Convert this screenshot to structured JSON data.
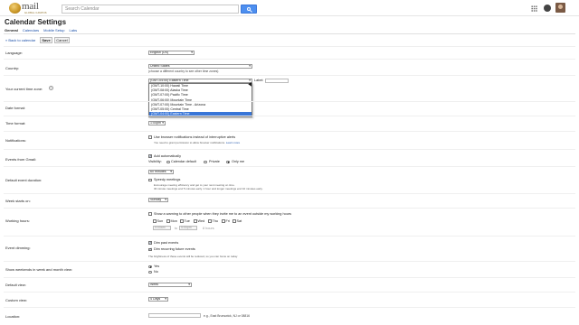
{
  "header": {
    "logo_text": "mail",
    "logo_subtext": "GLOBAL CAMPUS",
    "search_placeholder": "Search Calendar",
    "icons": [
      "search-icon",
      "apps-grid-icon",
      "notifications-icon",
      "avatar"
    ]
  },
  "page": {
    "title": "Calendar Settings",
    "tabs": [
      {
        "label": "General",
        "active": true
      },
      {
        "label": "Calendars",
        "active": false
      },
      {
        "label": "Mobile Setup",
        "active": false
      },
      {
        "label": "Labs",
        "active": false
      }
    ],
    "back_link": "« Back to calendar",
    "save_label": "Save",
    "cancel_label": "Cancel"
  },
  "settings": {
    "language": {
      "label": "Language:",
      "value": "English (US)"
    },
    "country": {
      "label": "Country:",
      "value": "United States",
      "hint": "(choose a different country to see other time zones)"
    },
    "timezone": {
      "label": "Your current time zone:",
      "help": "?",
      "value": "(GMT-04:00) Eastern Time",
      "side_label": "Label:",
      "options": [
        "(GMT-10:00) Hawaii Time",
        "(GMT-08:00) Alaska Time",
        "(GMT-07:00) Pacific Time",
        "(GMT-06:00) Mountain Time",
        "(GMT-07:00) Mountain Time - Arizona",
        "(GMT-05:00) Central Time",
        "(GMT-04:00) Eastern Time"
      ],
      "selected_index": 6
    },
    "date_format": {
      "label": "Date format:"
    },
    "time_format": {
      "label": "Time format:",
      "value": "1:00pm"
    },
    "notifications": {
      "label": "Notifications:",
      "checkbox": "Use browser notifications instead of interruptive alerts",
      "checked": false,
      "note": "You need to grant permission to allow browser notifications.",
      "note_link": "Learn more"
    },
    "events_from_gmail": {
      "label": "Events from Gmail:",
      "checkbox": "Add automatically",
      "checked": true,
      "visibility_label": "Visibility:",
      "visibility_options": [
        "Calendar default",
        "Private",
        "Only me"
      ],
      "visibility_selected": 2
    },
    "default_duration": {
      "label": "Default event duration:",
      "value": "60 minutes",
      "speedy_label": "Speedy meetings",
      "speedy_checked": false,
      "speedy_note1": "Encourage meeting efficiency and get to your next meeting on time.",
      "speedy_note2": "30 minute meetings end 5 minutes early. 1 hour and longer meetings end 10 minutes early."
    },
    "week_start": {
      "label": "Week starts on:",
      "value": "Sunday"
    },
    "working_hours": {
      "label": "Working hours:",
      "checkbox": "Show a warning to other people when they invite me to an event outside my working hours",
      "checked": false,
      "days": [
        "Sun",
        "Mon",
        "Tue",
        "Wed",
        "Thu",
        "Fri",
        "Sat"
      ],
      "from": "9:00am",
      "to_label": "to",
      "to": "5:00pm",
      "hours": "8 hours"
    },
    "event_dimming": {
      "label": "Event dimming:",
      "past": "Dim past events",
      "recurring": "Dim recurring future events",
      "note": "The brightness of these events will be reduced, so you can focus on today"
    },
    "weekends": {
      "label": "Show weekends in week and month view:",
      "yes": "Yes",
      "no": "No",
      "selected": "yes"
    },
    "default_view": {
      "label": "Default view:",
      "value": "Week"
    },
    "custom_view": {
      "label": "Custom view:",
      "value": "4 Days"
    },
    "location": {
      "label": "Location:",
      "hint": "e.g., East Brunswick, NJ or 08816"
    }
  },
  "colors": {
    "accent": "#4d8ff0",
    "link": "#1a4fa8",
    "selected_option": "#3875d7"
  }
}
